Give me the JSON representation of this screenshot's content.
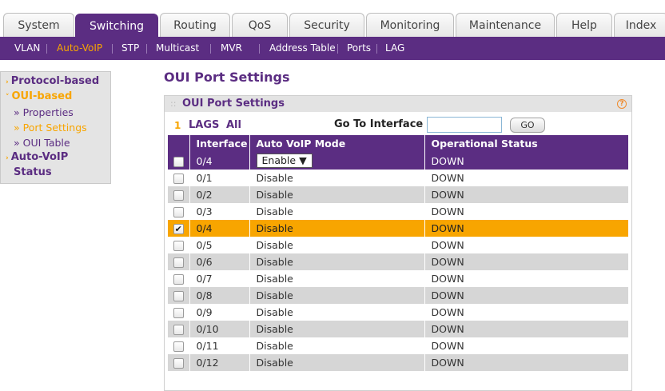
{
  "top_tabs": [
    {
      "label": "System",
      "active": false
    },
    {
      "label": "Switching",
      "active": true
    },
    {
      "label": "Routing",
      "active": false
    },
    {
      "label": "QoS",
      "active": false
    },
    {
      "label": "Security",
      "active": false
    },
    {
      "label": "Monitoring",
      "active": false
    },
    {
      "label": "Maintenance",
      "active": false
    },
    {
      "label": "Help",
      "active": false
    },
    {
      "label": "Index",
      "active": false
    }
  ],
  "sub_nav": [
    {
      "label": "VLAN",
      "active": false
    },
    {
      "label": "Auto-VoIP",
      "active": true
    },
    {
      "label": "STP",
      "active": false
    },
    {
      "label": "Multicast",
      "active": false
    },
    {
      "label": "MVR",
      "active": false
    },
    {
      "label": "Address Table",
      "active": false
    },
    {
      "label": "Ports",
      "active": false
    },
    {
      "label": "LAG",
      "active": false
    }
  ],
  "left_nav": {
    "protocol_based": "Protocol-based",
    "oui_based": "OUI-based",
    "properties": "» Properties",
    "port_settings": "» Port Settings",
    "oui_table": "» OUI Table",
    "auto_voip_status_line1": "Auto-VoIP",
    "auto_voip_status_line2": "Status"
  },
  "page_title": "OUI Port Settings",
  "panel": {
    "title": "OUI Port Settings",
    "help_glyph": "?"
  },
  "filter": {
    "page_num": "1",
    "lags": "LAGS",
    "all": "All",
    "goto_label": "Go To Interface",
    "goto_value": "",
    "go_button": "GO"
  },
  "table": {
    "headers": [
      "Interface",
      "Auto VoIP Mode",
      "Operational Status"
    ],
    "edit_row": {
      "interface": "0/4",
      "mode": "Enable",
      "status": "DOWN"
    },
    "rows": [
      {
        "interface": "0/1",
        "mode": "Disable",
        "status": "DOWN",
        "checked": false
      },
      {
        "interface": "0/2",
        "mode": "Disable",
        "status": "DOWN",
        "checked": false
      },
      {
        "interface": "0/3",
        "mode": "Disable",
        "status": "DOWN",
        "checked": false
      },
      {
        "interface": "0/4",
        "mode": "Disable",
        "status": "DOWN",
        "checked": true
      },
      {
        "interface": "0/5",
        "mode": "Disable",
        "status": "DOWN",
        "checked": false
      },
      {
        "interface": "0/6",
        "mode": "Disable",
        "status": "DOWN",
        "checked": false
      },
      {
        "interface": "0/7",
        "mode": "Disable",
        "status": "DOWN",
        "checked": false
      },
      {
        "interface": "0/8",
        "mode": "Disable",
        "status": "DOWN",
        "checked": false
      },
      {
        "interface": "0/9",
        "mode": "Disable",
        "status": "DOWN",
        "checked": false
      },
      {
        "interface": "0/10",
        "mode": "Disable",
        "status": "DOWN",
        "checked": false
      },
      {
        "interface": "0/11",
        "mode": "Disable",
        "status": "DOWN",
        "checked": false
      },
      {
        "interface": "0/12",
        "mode": "Disable",
        "status": "DOWN",
        "checked": false
      }
    ]
  },
  "colors": {
    "brand_purple": "#5b2d82",
    "accent_orange": "#f8a500",
    "row_gray": "#d6d6d6"
  }
}
